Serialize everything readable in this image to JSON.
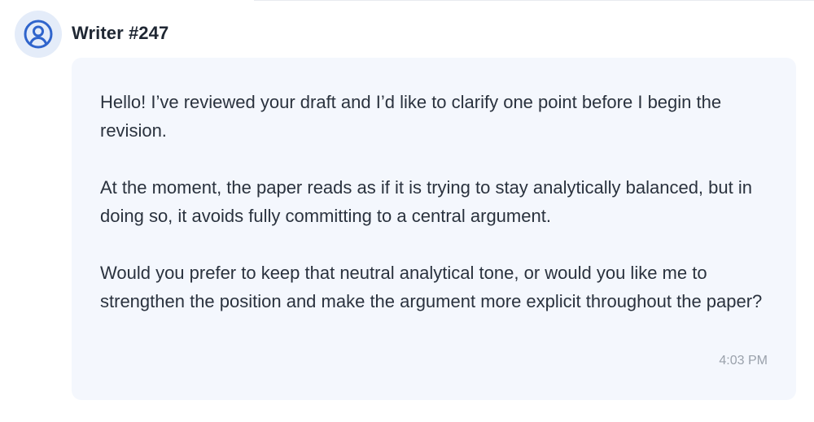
{
  "message": {
    "author": "Writer #247",
    "avatar_icon": "user-circle-icon",
    "paragraphs": [
      "Hello! I’ve reviewed your draft and I’d like to clarify one point before I begin the revision.",
      "At the moment, the paper reads as if it is trying to stay analytically balanced, but in doing so, it avoids fully committing to a central argument.",
      "Would you prefer to keep that neutral analytical tone, or would you like me to strengthen the position and make the argument more explicit throughout the paper?"
    ],
    "timestamp": "4:03 PM"
  },
  "colors": {
    "accent": "#2f64cc",
    "avatar_bg": "#e4ecf9",
    "bubble_bg": "#f4f7fd",
    "text": "#2a323e",
    "timestamp": "#9aa1ab"
  }
}
